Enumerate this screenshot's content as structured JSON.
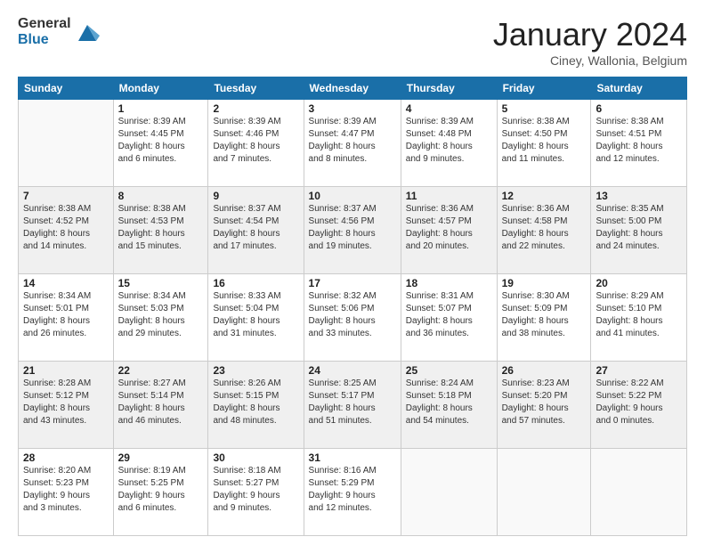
{
  "logo": {
    "general": "General",
    "blue": "Blue"
  },
  "header": {
    "month": "January 2024",
    "location": "Ciney, Wallonia, Belgium"
  },
  "weekdays": [
    "Sunday",
    "Monday",
    "Tuesday",
    "Wednesday",
    "Thursday",
    "Friday",
    "Saturday"
  ],
  "weeks": [
    [
      {
        "day": "",
        "info": ""
      },
      {
        "day": "1",
        "info": "Sunrise: 8:39 AM\nSunset: 4:45 PM\nDaylight: 8 hours\nand 6 minutes."
      },
      {
        "day": "2",
        "info": "Sunrise: 8:39 AM\nSunset: 4:46 PM\nDaylight: 8 hours\nand 7 minutes."
      },
      {
        "day": "3",
        "info": "Sunrise: 8:39 AM\nSunset: 4:47 PM\nDaylight: 8 hours\nand 8 minutes."
      },
      {
        "day": "4",
        "info": "Sunrise: 8:39 AM\nSunset: 4:48 PM\nDaylight: 8 hours\nand 9 minutes."
      },
      {
        "day": "5",
        "info": "Sunrise: 8:38 AM\nSunset: 4:50 PM\nDaylight: 8 hours\nand 11 minutes."
      },
      {
        "day": "6",
        "info": "Sunrise: 8:38 AM\nSunset: 4:51 PM\nDaylight: 8 hours\nand 12 minutes."
      }
    ],
    [
      {
        "day": "7",
        "info": "Sunrise: 8:38 AM\nSunset: 4:52 PM\nDaylight: 8 hours\nand 14 minutes."
      },
      {
        "day": "8",
        "info": "Sunrise: 8:38 AM\nSunset: 4:53 PM\nDaylight: 8 hours\nand 15 minutes."
      },
      {
        "day": "9",
        "info": "Sunrise: 8:37 AM\nSunset: 4:54 PM\nDaylight: 8 hours\nand 17 minutes."
      },
      {
        "day": "10",
        "info": "Sunrise: 8:37 AM\nSunset: 4:56 PM\nDaylight: 8 hours\nand 19 minutes."
      },
      {
        "day": "11",
        "info": "Sunrise: 8:36 AM\nSunset: 4:57 PM\nDaylight: 8 hours\nand 20 minutes."
      },
      {
        "day": "12",
        "info": "Sunrise: 8:36 AM\nSunset: 4:58 PM\nDaylight: 8 hours\nand 22 minutes."
      },
      {
        "day": "13",
        "info": "Sunrise: 8:35 AM\nSunset: 5:00 PM\nDaylight: 8 hours\nand 24 minutes."
      }
    ],
    [
      {
        "day": "14",
        "info": "Sunrise: 8:34 AM\nSunset: 5:01 PM\nDaylight: 8 hours\nand 26 minutes."
      },
      {
        "day": "15",
        "info": "Sunrise: 8:34 AM\nSunset: 5:03 PM\nDaylight: 8 hours\nand 29 minutes."
      },
      {
        "day": "16",
        "info": "Sunrise: 8:33 AM\nSunset: 5:04 PM\nDaylight: 8 hours\nand 31 minutes."
      },
      {
        "day": "17",
        "info": "Sunrise: 8:32 AM\nSunset: 5:06 PM\nDaylight: 8 hours\nand 33 minutes."
      },
      {
        "day": "18",
        "info": "Sunrise: 8:31 AM\nSunset: 5:07 PM\nDaylight: 8 hours\nand 36 minutes."
      },
      {
        "day": "19",
        "info": "Sunrise: 8:30 AM\nSunset: 5:09 PM\nDaylight: 8 hours\nand 38 minutes."
      },
      {
        "day": "20",
        "info": "Sunrise: 8:29 AM\nSunset: 5:10 PM\nDaylight: 8 hours\nand 41 minutes."
      }
    ],
    [
      {
        "day": "21",
        "info": "Sunrise: 8:28 AM\nSunset: 5:12 PM\nDaylight: 8 hours\nand 43 minutes."
      },
      {
        "day": "22",
        "info": "Sunrise: 8:27 AM\nSunset: 5:14 PM\nDaylight: 8 hours\nand 46 minutes."
      },
      {
        "day": "23",
        "info": "Sunrise: 8:26 AM\nSunset: 5:15 PM\nDaylight: 8 hours\nand 48 minutes."
      },
      {
        "day": "24",
        "info": "Sunrise: 8:25 AM\nSunset: 5:17 PM\nDaylight: 8 hours\nand 51 minutes."
      },
      {
        "day": "25",
        "info": "Sunrise: 8:24 AM\nSunset: 5:18 PM\nDaylight: 8 hours\nand 54 minutes."
      },
      {
        "day": "26",
        "info": "Sunrise: 8:23 AM\nSunset: 5:20 PM\nDaylight: 8 hours\nand 57 minutes."
      },
      {
        "day": "27",
        "info": "Sunrise: 8:22 AM\nSunset: 5:22 PM\nDaylight: 9 hours\nand 0 minutes."
      }
    ],
    [
      {
        "day": "28",
        "info": "Sunrise: 8:20 AM\nSunset: 5:23 PM\nDaylight: 9 hours\nand 3 minutes."
      },
      {
        "day": "29",
        "info": "Sunrise: 8:19 AM\nSunset: 5:25 PM\nDaylight: 9 hours\nand 6 minutes."
      },
      {
        "day": "30",
        "info": "Sunrise: 8:18 AM\nSunset: 5:27 PM\nDaylight: 9 hours\nand 9 minutes."
      },
      {
        "day": "31",
        "info": "Sunrise: 8:16 AM\nSunset: 5:29 PM\nDaylight: 9 hours\nand 12 minutes."
      },
      {
        "day": "",
        "info": ""
      },
      {
        "day": "",
        "info": ""
      },
      {
        "day": "",
        "info": ""
      }
    ]
  ]
}
